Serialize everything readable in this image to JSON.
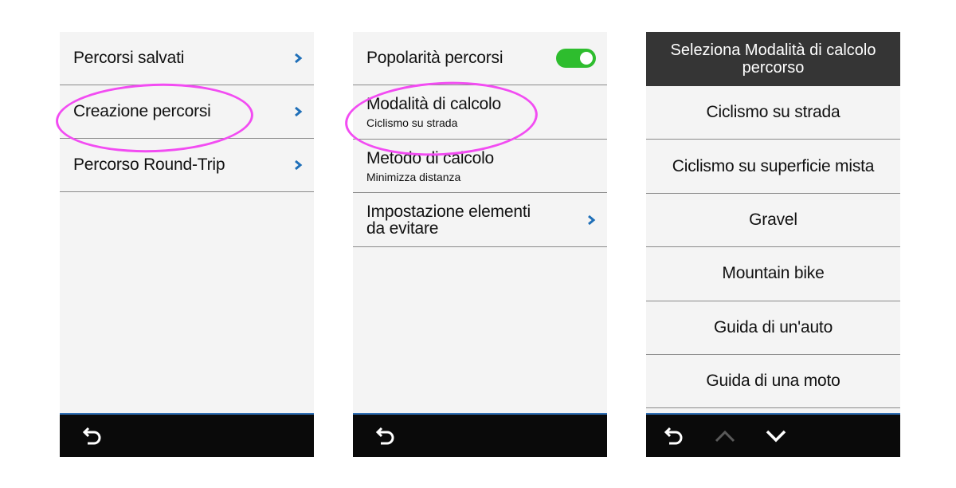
{
  "screen1": {
    "items": [
      {
        "label": "Percorsi salvati",
        "icon": "chevron-right-icon"
      },
      {
        "label": "Creazione percorsi",
        "icon": "chevron-right-icon"
      },
      {
        "label": "Percorso Round-Trip",
        "icon": "chevron-right-icon"
      }
    ],
    "bottom_bar": {
      "back_icon": "back-arrow-icon"
    }
  },
  "screen2": {
    "popularity": {
      "label": "Popolarità percorsi",
      "toggle_on": true
    },
    "calc_mode": {
      "label": "Modalità di calcolo",
      "value": "Ciclismo su strada"
    },
    "calc_method": {
      "label": "Metodo di calcolo",
      "value": "Minimizza distanza"
    },
    "avoid": {
      "label_line1": "Impostazione elementi",
      "label_line2": "da evitare",
      "icon": "chevron-right-icon"
    },
    "bottom_bar": {
      "back_icon": "back-arrow-icon"
    }
  },
  "screen3": {
    "header_line1": "Seleziona Modalità di calcolo",
    "header_line2": "percorso",
    "options": [
      "Ciclismo su strada",
      "Ciclismo su superficie mista",
      "Gravel",
      "Mountain bike",
      "Guida di un'auto",
      "Guida di una moto"
    ],
    "bottom_bar": {
      "icons": [
        "back-arrow-icon",
        "chevron-up-icon",
        "chevron-down-icon"
      ]
    }
  },
  "colors": {
    "toggle_on": "#2ebd2e",
    "chevron": "#1f6fb8",
    "highlight_ring": "#f24cf2",
    "bottom_bar": "#0a0a0a",
    "header": "#353535"
  }
}
